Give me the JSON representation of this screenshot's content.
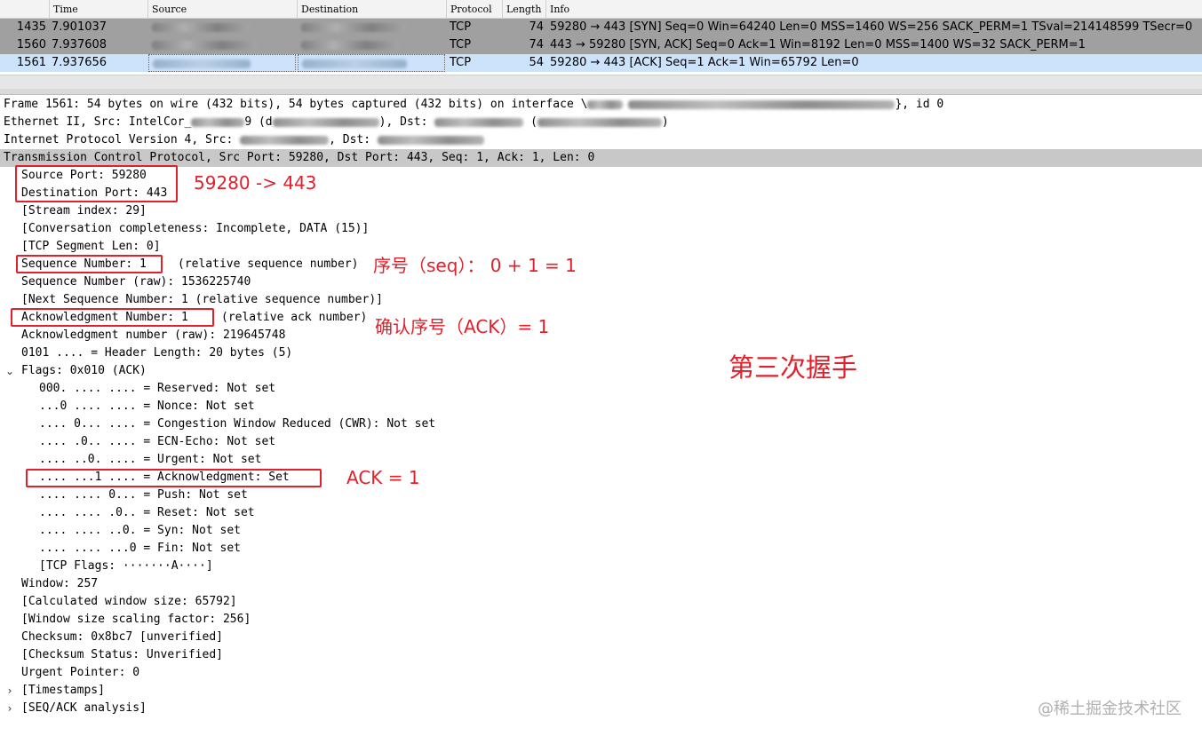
{
  "packet_list": {
    "columns": [
      "Time",
      "Source",
      "Destination",
      "Protocol",
      "Length",
      "Info"
    ],
    "rows": [
      {
        "no": "1435",
        "time": "7.901037",
        "protocol": "TCP",
        "length": "74",
        "info": "59280 → 443 [SYN] Seq=0 Win=64240 Len=0 MSS=1460 WS=256 SACK_PERM=1 TSval=214148599 TSecr=0"
      },
      {
        "no": "1560",
        "time": "7.937608",
        "protocol": "TCP",
        "length": "74",
        "info": "443 → 59280 [SYN, ACK] Seq=0 Ack=1 Win=8192 Len=0 MSS=1400 WS=32 SACK_PERM=1"
      },
      {
        "no": "1561",
        "time": "7.937656",
        "protocol": "TCP",
        "length": "54",
        "info": "59280 → 443 [ACK] Seq=1 Ack=1 Win=65792 Len=0"
      }
    ]
  },
  "details": {
    "frame": "Frame 1561: 54 bytes on wire (432 bits), 54 bytes captured (432 bits) on interface \\",
    "frame_tail": "}, id 0",
    "ethernet_a": "Ethernet II, Src: IntelCor_",
    "ethernet_b": "9 (d",
    "ethernet_c": "), Dst: ",
    "ethernet_d": " (",
    "ethernet_e": ")",
    "ip_a": "Internet Protocol Version 4, Src: ",
    "ip_b": ", Dst: ",
    "tcp": "Transmission Control Protocol, Src Port: 59280, Dst Port: 443, Seq: 1, Ack: 1, Len: 0",
    "src_port": "Source Port: 59280",
    "dst_port": "Destination Port: 443",
    "stream_index": "[Stream index: 29]",
    "conv": "[Conversation completeness: Incomplete, DATA (15)]",
    "seg_len": "[TCP Segment Len: 0]",
    "seq": "Sequence Number: 1",
    "seq_note": "(relative sequence number)",
    "seq_raw": "Sequence Number (raw): 1536225740",
    "next_seq": "[Next Sequence Number: 1    (relative sequence number)]",
    "ack": "Acknowledgment Number: 1",
    "ack_note": "(relative ack number)",
    "ack_raw": "Acknowledgment number (raw): 219645748",
    "header_len": "0101 .... = Header Length: 20 bytes (5)",
    "flags": "Flags: 0x010 (ACK)",
    "flag_reserved": "000. .... .... = Reserved: Not set",
    "flag_nonce": "...0 .... .... = Nonce: Not set",
    "flag_cwr": ".... 0... .... = Congestion Window Reduced (CWR): Not set",
    "flag_ecn": ".... .0.. .... = ECN-Echo: Not set",
    "flag_urg": ".... ..0. .... = Urgent: Not set",
    "flag_ack": ".... ...1 .... = Acknowledgment: Set",
    "flag_push": ".... .... 0... = Push: Not set",
    "flag_reset": ".... .... .0.. = Reset: Not set",
    "flag_syn": ".... .... ..0. = Syn: Not set",
    "flag_fin": ".... .... ...0 = Fin: Not set",
    "tcp_flags": "[TCP Flags: ·······A····]",
    "window": "Window: 257",
    "calc_window": "[Calculated window size: 65792]",
    "scaling": "[Window size scaling factor: 256]",
    "checksum": "Checksum: 0x8bc7 [unverified]",
    "checksum_status": "[Checksum Status: Unverified]",
    "urgent_ptr": "Urgent Pointer: 0",
    "timestamps": "[Timestamps]",
    "seq_ack": "[SEQ/ACK analysis]"
  },
  "annotations": {
    "ports": "59280 -> 443",
    "seq": "序号（seq）： 0 + 1 = 1",
    "ack": "确认序号（ACK）= 1",
    "handshake": "第三次握手",
    "ack_flag": "ACK = 1"
  },
  "watermark": "@稀土掘金技术社区",
  "colors": {
    "annotation_red": "#e0202a",
    "selected_row": "#cce3fb",
    "gray_row": "#a0a0a0",
    "highlight_row": "#c8c8c8"
  }
}
